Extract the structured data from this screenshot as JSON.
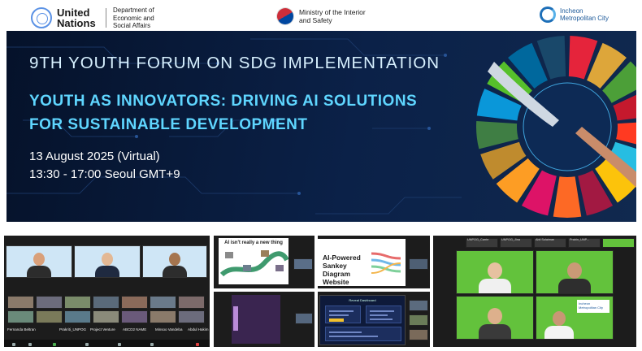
{
  "header": {
    "un_name": "United Nations",
    "un_dept": "Department of Economic and Social Affairs",
    "moi": "Ministry of the Interior and Safety",
    "incheon": "Incheon Metropolitan City"
  },
  "banner": {
    "title": "9TH YOUTH FORUM ON SDG IMPLEMENTATION",
    "subtitle": "YOUTH AS INNOVATORS: DRIVING AI SOLUTIONS FOR SUSTAINABLE DEVELOPMENT",
    "date": "13 August 2025 (Virtual)",
    "time": "13:30 - 17:00 Seoul GMT+9"
  },
  "sdg_colors": [
    "#e5243b",
    "#dda63a",
    "#4c9f38",
    "#c5192d",
    "#ff3a21",
    "#26bde2",
    "#fcc30b",
    "#a21942",
    "#fd6925",
    "#dd1367",
    "#fd9d24",
    "#bf8b2e",
    "#3f7e44",
    "#0a97d9",
    "#56c02b",
    "#00689d",
    "#19486a"
  ],
  "gallery": {
    "p1_names": [
      "Fernanda Beltran",
      "Prakriti_UNPOG",
      "Project Venture",
      "ABCD2 NAME",
      "Minsoo Vandeba",
      "Abdul Hakim"
    ],
    "p2_slide_title": "AI isn't really a new thing",
    "p4_slide_title": "AI-Powered Sankey Diagram Website",
    "p5_dash_title": "Reveal Dashboard",
    "p6_top_names": [
      "UNPOG_Carrie",
      "UNPOG_Jina",
      "Abil Sulaiman",
      "Prabin_UNP..."
    ],
    "p6_logo_text": "Incheon Metropolitan City"
  }
}
